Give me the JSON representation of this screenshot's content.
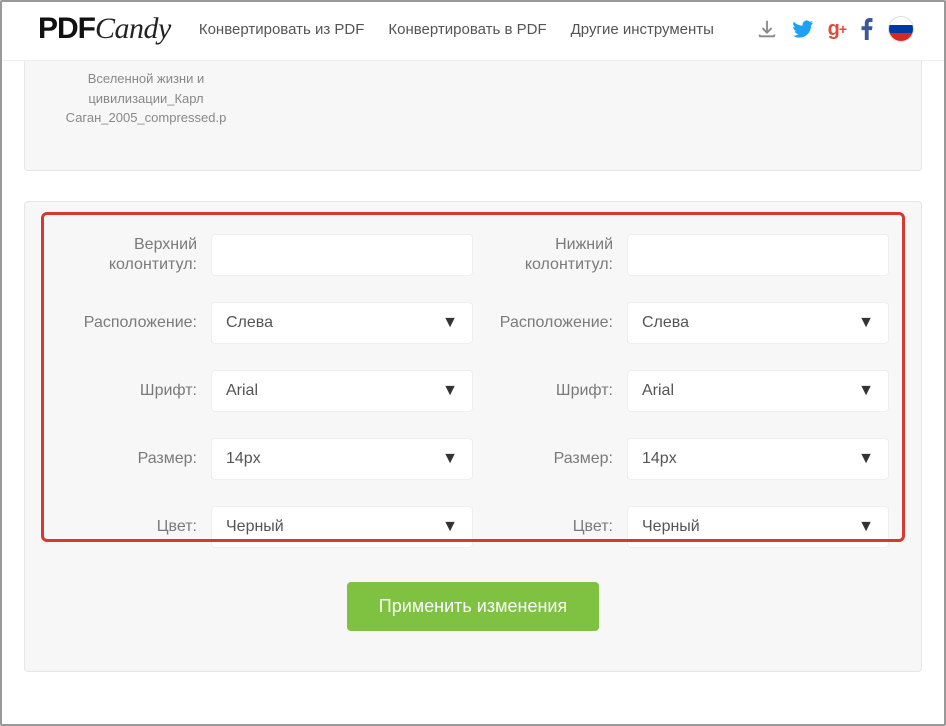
{
  "logo_pdf": "PDF",
  "logo_candy": "Candy",
  "nav": {
    "from_pdf": "Конвертировать из PDF",
    "to_pdf": "Конвертировать в PDF",
    "other": "Другие инструменты"
  },
  "file": {
    "name": "Вселенной жизни и цивилизации_Карл Саган_2005_compressed.p"
  },
  "settings": {
    "header": {
      "title_label": "Верхний колонтитул:",
      "title_value": "",
      "position_label": "Расположение:",
      "position_value": "Слева",
      "font_label": "Шрифт:",
      "font_value": "Arial",
      "size_label": "Размер:",
      "size_value": "14px",
      "color_label": "Цвет:",
      "color_value": "Черный"
    },
    "footer": {
      "title_label": "Нижний колонтитул:",
      "title_value": "",
      "position_label": "Расположение:",
      "position_value": "Слева",
      "font_label": "Шрифт:",
      "font_value": "Arial",
      "size_label": "Размер:",
      "size_value": "14px",
      "color_label": "Цвет:",
      "color_value": "Черный"
    },
    "apply_label": "Применить изменения"
  }
}
